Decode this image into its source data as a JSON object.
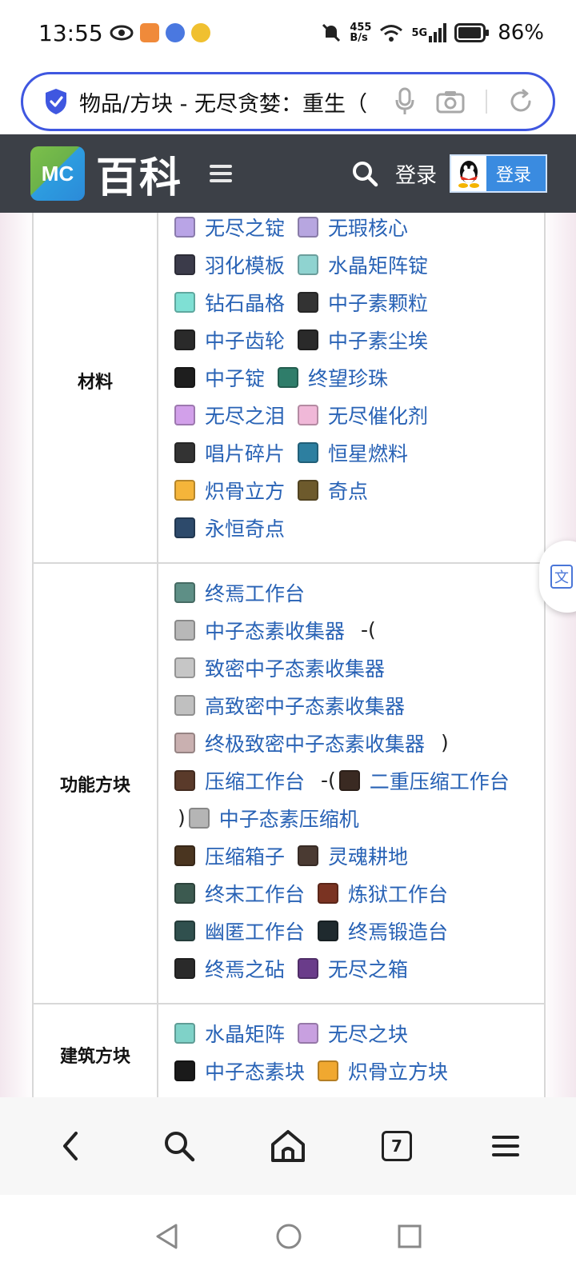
{
  "status_bar": {
    "time": "13:55",
    "net_speed_top": "455",
    "net_speed_bottom": "B/s",
    "network": "5G",
    "battery": "86%"
  },
  "address_bar": {
    "url_text": "物品/方块 - 无尽贪婪：重生（"
  },
  "site_header": {
    "logo_mc": "MC",
    "logo_text": "百科",
    "login_text": "登录",
    "login_button": "登录"
  },
  "nav_table": {
    "sections": [
      {
        "category": "材料",
        "lines": [
          [
            {
              "label": "无尽之锭",
              "icon": "ingot-icon",
              "color": "#b9a4e6"
            },
            {
              "label": "无瑕核心",
              "icon": "core-icon",
              "color": "#b7a6e0"
            }
          ],
          [
            {
              "label": "羽化模板",
              "icon": "template-icon",
              "color": "#3b3b4a"
            },
            {
              "label": "水晶矩阵锭",
              "icon": "crystal-ingot-icon",
              "color": "#8fd3d0"
            }
          ],
          [
            {
              "label": "钻石晶格",
              "icon": "diamond-lattice-icon",
              "color": "#7fe0d4"
            },
            {
              "label": "中子素颗粒",
              "icon": "neutron-nugget-icon",
              "color": "#333333"
            }
          ],
          [
            {
              "label": "中子齿轮",
              "icon": "neutron-gear-icon",
              "color": "#2a2a2a"
            },
            {
              "label": "中子素尘埃",
              "icon": "neutron-dust-icon",
              "color": "#2a2a2a"
            }
          ],
          [
            {
              "label": "中子锭",
              "icon": "neutron-ingot-icon",
              "color": "#1e1e1e"
            },
            {
              "label": "终望珍珠",
              "icon": "pearl-icon",
              "color": "#2f7d6a"
            }
          ],
          [
            {
              "label": "无尽之泪",
              "icon": "tear-icon",
              "color": "#d2a0ea"
            },
            {
              "label": "无尽催化剂",
              "icon": "catalyst-icon",
              "color": "#f0b8d8"
            }
          ],
          [
            {
              "label": "唱片碎片",
              "icon": "disc-fragment-icon",
              "color": "#333333"
            },
            {
              "label": "恒星燃料",
              "icon": "star-fuel-icon",
              "color": "#2d7fa0"
            }
          ],
          [
            {
              "label": "炽骨立方",
              "icon": "bone-cube-icon",
              "color": "#f5b53a"
            },
            {
              "label": "奇点",
              "icon": "singularity-icon",
              "color": "#6d5a2c"
            }
          ],
          [
            {
              "label": "永恒奇点",
              "icon": "eternal-singularity-icon",
              "color": "#2d4a6b"
            }
          ]
        ]
      },
      {
        "category": "功能方块",
        "lines": [
          [
            {
              "label": "终焉工作台",
              "icon": "extreme-table-icon",
              "color": "#5e8f86"
            }
          ],
          [
            {
              "label": "中子态素收集器",
              "icon": "collector-icon",
              "color": "#b8b8b8"
            },
            {
              "text": "-("
            }
          ],
          [
            {
              "label": "致密中子态素收集器",
              "icon": "dense-collector-icon",
              "color": "#c6c6c6"
            }
          ],
          [
            {
              "label": "高致密中子态素收集器",
              "icon": "high-dense-collector-icon",
              "color": "#c0c0c0"
            }
          ],
          [
            {
              "label": "终极致密中子态素收集器",
              "icon": "ultimate-collector-icon",
              "color": "#c9b0b0"
            },
            {
              "text": ")"
            }
          ],
          [
            {
              "label": "压缩工作台",
              "icon": "compress-table-icon",
              "color": "#5a3a2a"
            },
            {
              "text": "-("
            },
            {
              "label": "二重压缩工作台",
              "icon": "double-compress-icon",
              "color": "#3a2a22"
            }
          ],
          [
            {
              "text": ")"
            },
            {
              "label": "中子态素压缩机",
              "icon": "compressor-icon",
              "color": "#b5b5b5"
            }
          ],
          [
            {
              "label": "压缩箱子",
              "icon": "compress-chest-icon",
              "color": "#4a3520"
            },
            {
              "label": "灵魂耕地",
              "icon": "soul-farmland-icon",
              "color": "#4a3a32"
            }
          ],
          [
            {
              "label": "终末工作台",
              "icon": "end-table-icon",
              "color": "#3c5a50"
            },
            {
              "label": "炼狱工作台",
              "icon": "nether-table-icon",
              "color": "#7a3322"
            }
          ],
          [
            {
              "label": "幽匿工作台",
              "icon": "sculk-table-icon",
              "color": "#30504e"
            },
            {
              "label": "终焉锻造台",
              "icon": "extreme-smithing-icon",
              "color": "#1f2a2e"
            }
          ],
          [
            {
              "label": "终焉之砧",
              "icon": "anvil-icon",
              "color": "#2a2a2a"
            },
            {
              "label": "无尽之箱",
              "icon": "infinity-chest-icon",
              "color": "#6a3c8a"
            }
          ]
        ]
      },
      {
        "category": "建筑方块",
        "lines": [
          [
            {
              "label": "水晶矩阵",
              "icon": "crystal-matrix-icon",
              "color": "#7fd2c8"
            },
            {
              "label": "无尽之块",
              "icon": "infinity-block-icon",
              "color": "#c8a0e0"
            }
          ],
          [
            {
              "label": "中子态素块",
              "icon": "neutron-block-icon",
              "color": "#1a1a1a"
            },
            {
              "label": "炽骨立方块",
              "icon": "bone-block-icon",
              "color": "#f0a830"
            }
          ]
        ]
      }
    ]
  },
  "floating": {
    "translate_label": "文"
  },
  "bottom_nav": {
    "tab_count": "7"
  }
}
